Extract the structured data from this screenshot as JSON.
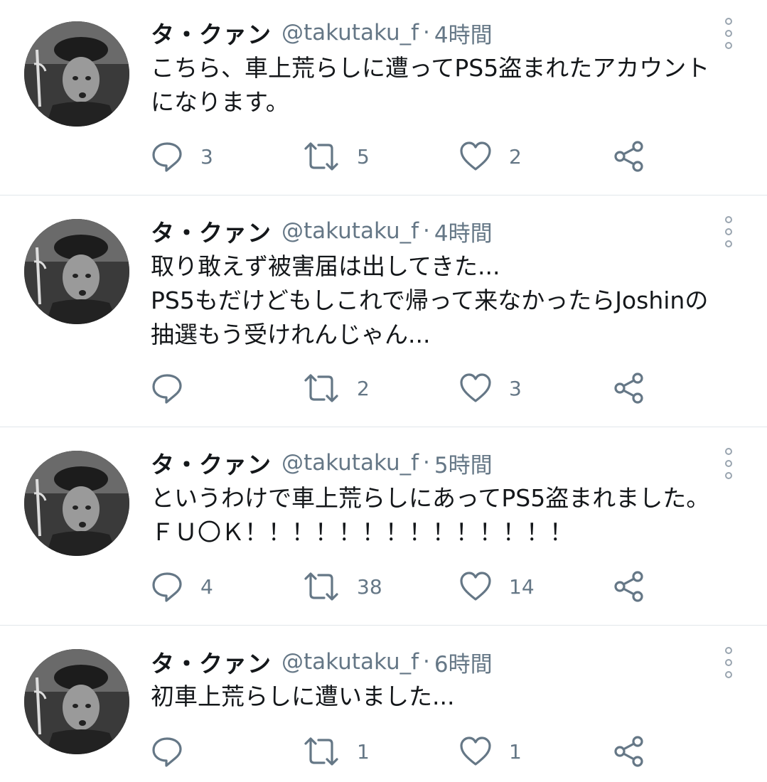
{
  "tweets": [
    {
      "name": "タ・クァン",
      "handle": "@takutaku_f",
      "sep": "·",
      "time": "4時間",
      "lines": [
        "こちら、車上荒らしに遭ってPS5盗まれたアカウント",
        "になります。"
      ],
      "replies": "3",
      "retweets": "5",
      "likes": "2"
    },
    {
      "name": "タ・クァン",
      "handle": "@takutaku_f",
      "sep": "·",
      "time": "4時間",
      "lines": [
        "取り敢えず被害届は出してきた...",
        "PS5もだけどもしこれで帰って来なかったらJoshinの",
        "抽選もう受けれんじゃん..."
      ],
      "replies": "",
      "retweets": "2",
      "likes": "3"
    },
    {
      "name": "タ・クァン",
      "handle": "@takutaku_f",
      "sep": "·",
      "time": "5時間",
      "lines": [
        "というわけで車上荒らしにあってPS5盗まれました。",
        "ＦＵ〇Ｋ！！！！！！！！！！！！！！"
      ],
      "replies": "4",
      "retweets": "38",
      "likes": "14"
    },
    {
      "name": "タ・クァン",
      "handle": "@takutaku_f",
      "sep": "·",
      "time": "6時間",
      "lines": [
        "初車上荒らしに遭いました..."
      ],
      "replies": "",
      "retweets": "1",
      "likes": "1"
    }
  ],
  "icons": {
    "reply": "reply-icon",
    "retweet": "retweet-icon",
    "like": "heart-icon",
    "share": "share-icon",
    "more": "more-vertical-icon"
  },
  "colors": {
    "text": "#14171a",
    "secondary": "#657786",
    "divider": "#e1e6ea"
  }
}
